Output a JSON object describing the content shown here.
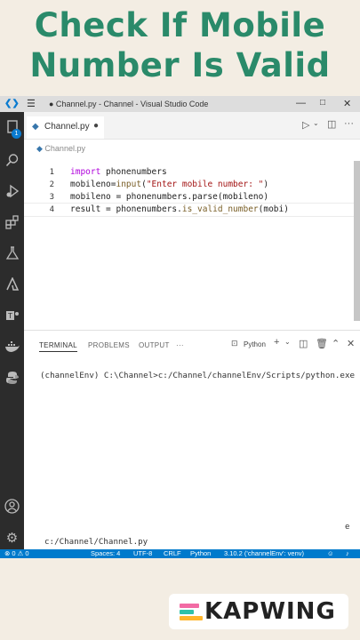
{
  "banner": {
    "line1": "Check If Mobile",
    "line2": "Number Is Valid"
  },
  "window": {
    "title": "● Channel.py - Channel - Visual Studio Code"
  },
  "colors": {
    "accent": "#2a8a6a",
    "statusbar": "#007acc"
  },
  "activity": {
    "badge": "1"
  },
  "tabs": [
    {
      "label": "Channel.py"
    }
  ],
  "breadcrumb": "Channel.py",
  "code": {
    "line_numbers": [
      "1",
      "2",
      "3",
      "4"
    ],
    "l1_kw": "import",
    "l1_rest": " phonenumbers",
    "l2_a": "mobileno=",
    "l2_fn": "input",
    "l2_b": "(",
    "l2_str": "\"Enter mobile number: \"",
    "l2_c": ")",
    "l3": "mobileno = phonenumbers.parse(mobileno)",
    "l4_a": "result = phonenumbers.",
    "l4_fn": "is_valid_number",
    "l4_b": "(mobi)"
  },
  "panel": {
    "tabs": [
      "TERMINAL",
      "PROBLEMS",
      "OUTPUT",
      "···"
    ],
    "shell": "Python",
    "line1": "(channelEnv) C:\\Channel>c:/Channel/channelEnv/Scripts/python.exe",
    "line2": "c:/Channel/Channel.py",
    "line2_end": "e"
  },
  "status": {
    "errors": "⊗ 0 ⚠ 0",
    "spaces": "Spaces: 4",
    "encoding": "UTF-8",
    "eol": "CRLF",
    "language": "Python",
    "interpreter": "3.10.2 ('channelEnv': venv)"
  },
  "watermark": {
    "text": "KAPWING"
  }
}
